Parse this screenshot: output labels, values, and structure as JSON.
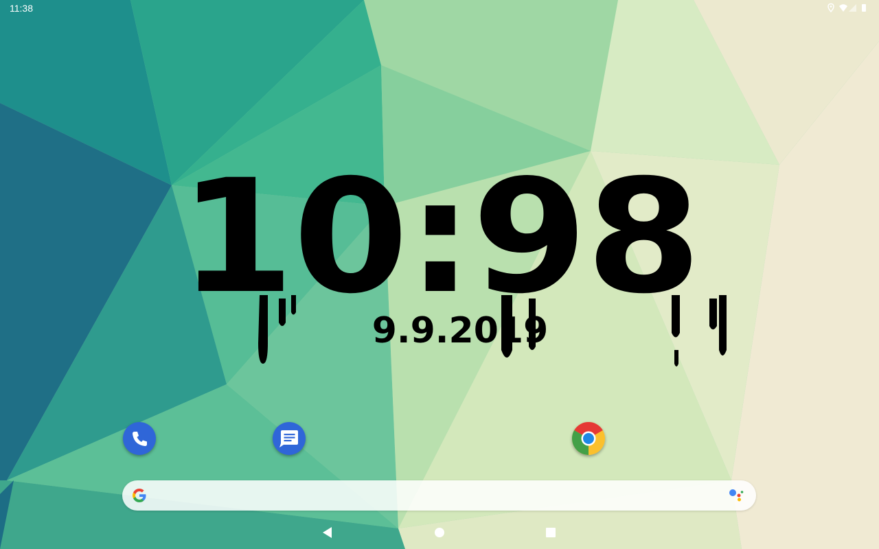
{
  "status_bar": {
    "time": "11:38",
    "icons": [
      "location-icon",
      "wifi-icon",
      "cellular-signal-icon",
      "battery-icon"
    ]
  },
  "clock_widget": {
    "time": "10:98",
    "date": "9.9.2019"
  },
  "dock": {
    "apps": [
      {
        "name": "Phone",
        "icon": "phone-icon",
        "color": "#2f66d8"
      },
      {
        "name": "Messages",
        "icon": "messages-icon",
        "color": "#2f66d8"
      },
      {
        "name": "Chrome",
        "icon": "chrome-icon"
      }
    ]
  },
  "search_bar": {
    "left_icon": "google-g-icon",
    "right_icon": "google-assistant-icon"
  },
  "nav_bar": {
    "buttons": [
      "back-icon",
      "home-icon",
      "recents-icon"
    ]
  },
  "colors": {
    "wallpaper_teal": "#1f7f86",
    "wallpaper_green": "#37b493",
    "wallpaper_cream": "#efe9cf",
    "clock_text": "#000000"
  }
}
